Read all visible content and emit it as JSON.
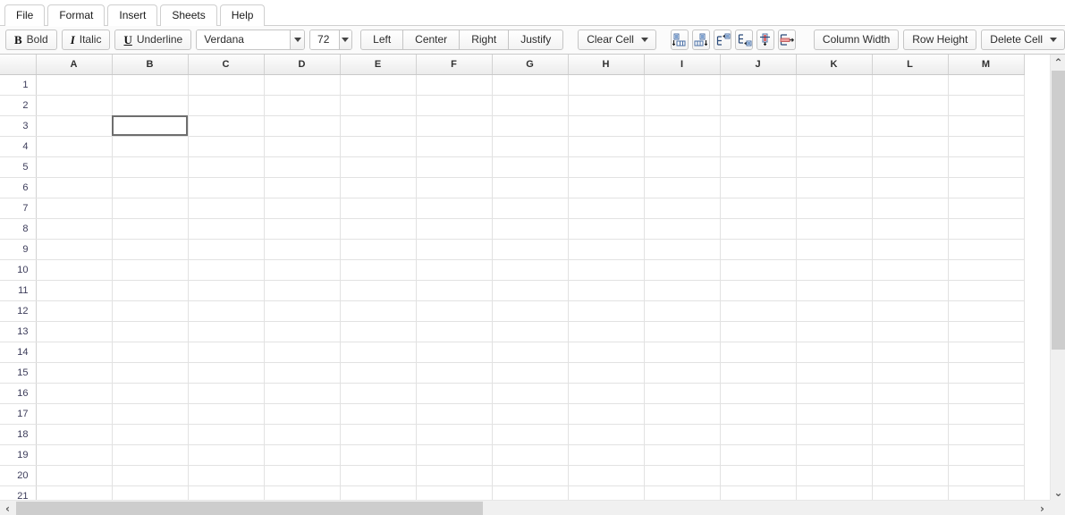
{
  "menu": {
    "tabs": [
      {
        "label": "File",
        "active": false
      },
      {
        "label": "Format",
        "active": true
      },
      {
        "label": "Insert",
        "active": false
      },
      {
        "label": "Sheets",
        "active": false
      },
      {
        "label": "Help",
        "active": false
      }
    ]
  },
  "toolbar": {
    "bold_label": "Bold",
    "bold_glyph": "B",
    "italic_label": "Italic",
    "italic_glyph": "I",
    "underline_label": "Underline",
    "underline_glyph": "U",
    "font_family_value": "Verdana",
    "font_size_value": "72",
    "align_left_label": "Left",
    "align_center_label": "Center",
    "align_right_label": "Right",
    "align_justify_label": "Justify",
    "clear_cell_label": "Clear Cell",
    "icon_buttons": [
      {
        "name": "insert-column-before-icon"
      },
      {
        "name": "insert-column-after-icon"
      },
      {
        "name": "insert-row-above-icon"
      },
      {
        "name": "insert-row-below-icon"
      },
      {
        "name": "delete-column-icon"
      },
      {
        "name": "delete-row-icon"
      }
    ],
    "column_width_label": "Column Width",
    "row_height_label": "Row Height",
    "delete_cell_label": "Delete Cell"
  },
  "sheet": {
    "columns": [
      "A",
      "B",
      "C",
      "D",
      "E",
      "F",
      "G",
      "H",
      "I",
      "J",
      "K",
      "L",
      "M"
    ],
    "rows": [
      "1",
      "2",
      "3",
      "4",
      "5",
      "6",
      "7",
      "8",
      "9",
      "10",
      "11",
      "12",
      "13",
      "14",
      "15",
      "16",
      "17",
      "18",
      "19",
      "20",
      "21"
    ],
    "selected_cell": "B3",
    "cell_values": {}
  },
  "scrollbars": {
    "vertical_up_glyph": "⌃",
    "vertical_down_glyph": "⌄",
    "horizontal_left_glyph": "‹",
    "horizontal_right_glyph": "›"
  },
  "colors": {
    "selection_border": "#6e6e6e",
    "grid_line": "#e2e2e2",
    "header_text": "#303030",
    "scrollbar_thumb": "#cdcdcd"
  }
}
